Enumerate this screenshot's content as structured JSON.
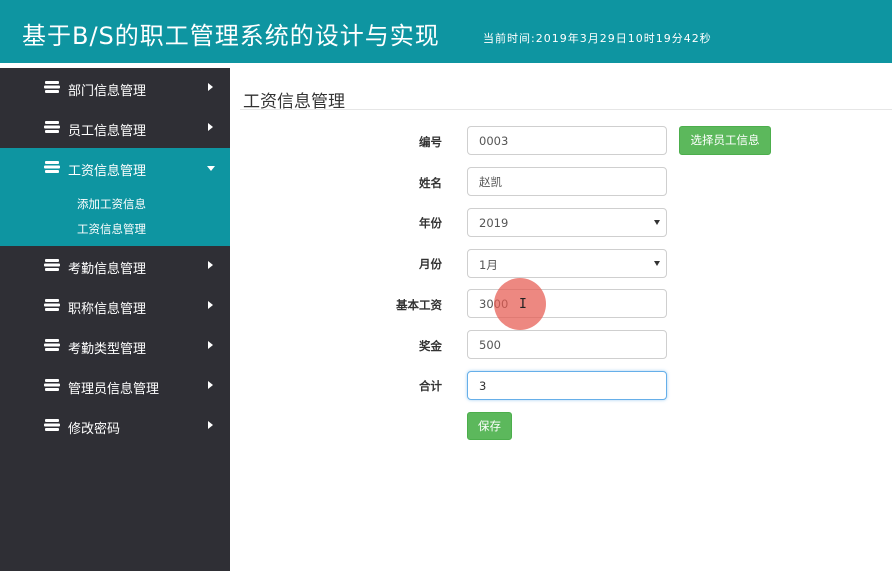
{
  "header": {
    "title": "基于B/S的职工管理系统的设计与实现",
    "time": "当前时间:2019年3月29日10时19分42秒"
  },
  "sidebar": {
    "items": [
      {
        "label": "部门信息管理",
        "icon": "layers-icon"
      },
      {
        "label": "员工信息管理",
        "icon": "layers-icon"
      },
      {
        "label": "工资信息管理",
        "icon": "layers-icon",
        "active": true
      },
      {
        "label": "考勤信息管理",
        "icon": "layers-icon"
      },
      {
        "label": "职称信息管理",
        "icon": "layers-icon"
      },
      {
        "label": "考勤类型管理",
        "icon": "layers-icon"
      },
      {
        "label": "管理员信息管理",
        "icon": "layers-icon"
      },
      {
        "label": "修改密码",
        "icon": "layers-icon"
      }
    ],
    "submenu": [
      "添加工资信息",
      "工资信息管理"
    ]
  },
  "main": {
    "page_title": "工资信息管理",
    "form": {
      "id_label": "编号",
      "id_value": "0003",
      "select_employee_button": "选择员工信息",
      "name_label": "姓名",
      "name_value": "赵凯",
      "year_label": "年份",
      "year_value": "2019",
      "month_label": "月份",
      "month_value": "1月",
      "base_salary_label": "基本工资",
      "base_salary_value": "3000",
      "bonus_label": "奖金",
      "bonus_value": "500",
      "total_label": "合计",
      "total_value": "3",
      "save_button": "保存"
    }
  },
  "colors": {
    "accent": "#0e95a1",
    "sidebar_bg": "#2f2f35",
    "button_green": "#5cb85c"
  }
}
